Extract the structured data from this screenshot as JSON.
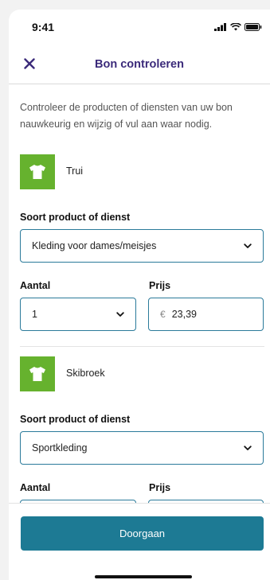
{
  "status_bar": {
    "time": "9:41"
  },
  "nav": {
    "title": "Bon controleren",
    "close_icon": "close-icon"
  },
  "intro_text": "Controleer de producten of diensten van uw bon nauwkeurig en wijzig of vul aan waar nodig.",
  "labels": {
    "product_type": "Soort product of dienst",
    "quantity": "Aantal",
    "price": "Prijs",
    "currency": "€"
  },
  "products": [
    {
      "name": "Trui",
      "icon": "tshirt-icon",
      "type": "Kleding voor dames/meisjes",
      "quantity": "1",
      "price": "23,39"
    },
    {
      "name": "Skibroek",
      "icon": "tshirt-icon",
      "type": "Sportkleding",
      "quantity": "",
      "price": ""
    }
  ],
  "footer": {
    "button_label": "Doorgaan"
  },
  "colors": {
    "accent": "#3b2a7a",
    "icon_bg": "#66b22e",
    "button": "#1d7a94",
    "border": "#2a7a9a"
  }
}
